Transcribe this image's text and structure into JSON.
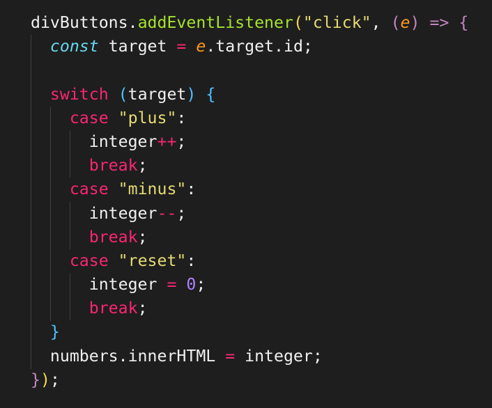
{
  "editor": {
    "background": "#1e1e1e",
    "lines": [
      [
        {
          "text": "divButtons.",
          "class": "tok-text"
        },
        {
          "text": "addEventListener",
          "class": "tok-method"
        },
        {
          "text": "(",
          "class": "tok-brace-yellow"
        },
        {
          "text": "\"click\"",
          "class": "tok-string"
        },
        {
          "text": ", ",
          "class": "tok-text"
        },
        {
          "text": "(",
          "class": "tok-brace-magenta"
        },
        {
          "text": "e",
          "class": "tok-param"
        },
        {
          "text": ")",
          "class": "tok-brace-magenta"
        },
        {
          "text": " ",
          "class": "tok-text"
        },
        {
          "text": "=>",
          "class": "tok-arrow"
        },
        {
          "text": " ",
          "class": "tok-text"
        },
        {
          "text": "{",
          "class": "tok-brace-magenta"
        }
      ],
      [
        {
          "text": "  ",
          "class": "tok-text"
        },
        {
          "text": "const",
          "class": "tok-storage"
        },
        {
          "text": " target ",
          "class": "tok-text"
        },
        {
          "text": "=",
          "class": "tok-keyword"
        },
        {
          "text": " ",
          "class": "tok-text"
        },
        {
          "text": "e",
          "class": "tok-param"
        },
        {
          "text": ".target.id;",
          "class": "tok-text"
        }
      ],
      [],
      [
        {
          "text": "  ",
          "class": "tok-text"
        },
        {
          "text": "switch",
          "class": "tok-keyword"
        },
        {
          "text": " ",
          "class": "tok-text"
        },
        {
          "text": "(",
          "class": "tok-brace-blue"
        },
        {
          "text": "target",
          "class": "tok-text"
        },
        {
          "text": ")",
          "class": "tok-brace-blue"
        },
        {
          "text": " ",
          "class": "tok-text"
        },
        {
          "text": "{",
          "class": "tok-brace-blue"
        }
      ],
      [
        {
          "text": "    ",
          "class": "tok-text"
        },
        {
          "text": "case",
          "class": "tok-keyword"
        },
        {
          "text": " ",
          "class": "tok-text"
        },
        {
          "text": "\"plus\"",
          "class": "tok-string"
        },
        {
          "text": ":",
          "class": "tok-text"
        }
      ],
      [
        {
          "text": "      integer",
          "class": "tok-text"
        },
        {
          "text": "++",
          "class": "tok-keyword"
        },
        {
          "text": ";",
          "class": "tok-text"
        }
      ],
      [
        {
          "text": "      ",
          "class": "tok-text"
        },
        {
          "text": "break",
          "class": "tok-keyword"
        },
        {
          "text": ";",
          "class": "tok-text"
        }
      ],
      [
        {
          "text": "    ",
          "class": "tok-text"
        },
        {
          "text": "case",
          "class": "tok-keyword"
        },
        {
          "text": " ",
          "class": "tok-text"
        },
        {
          "text": "\"minus\"",
          "class": "tok-string"
        },
        {
          "text": ":",
          "class": "tok-text"
        }
      ],
      [
        {
          "text": "      integer",
          "class": "tok-text"
        },
        {
          "text": "--",
          "class": "tok-keyword"
        },
        {
          "text": ";",
          "class": "tok-text"
        }
      ],
      [
        {
          "text": "      ",
          "class": "tok-text"
        },
        {
          "text": "break",
          "class": "tok-keyword"
        },
        {
          "text": ";",
          "class": "tok-text"
        }
      ],
      [
        {
          "text": "    ",
          "class": "tok-text"
        },
        {
          "text": "case",
          "class": "tok-keyword"
        },
        {
          "text": " ",
          "class": "tok-text"
        },
        {
          "text": "\"reset\"",
          "class": "tok-string"
        },
        {
          "text": ":",
          "class": "tok-text"
        }
      ],
      [
        {
          "text": "      integer ",
          "class": "tok-text"
        },
        {
          "text": "=",
          "class": "tok-keyword"
        },
        {
          "text": " ",
          "class": "tok-text"
        },
        {
          "text": "0",
          "class": "tok-number"
        },
        {
          "text": ";",
          "class": "tok-text"
        }
      ],
      [
        {
          "text": "      ",
          "class": "tok-text"
        },
        {
          "text": "break",
          "class": "tok-keyword"
        },
        {
          "text": ";",
          "class": "tok-text"
        }
      ],
      [
        {
          "text": "  ",
          "class": "tok-text"
        },
        {
          "text": "}",
          "class": "tok-brace-blue"
        }
      ],
      [
        {
          "text": "  numbers.innerHTML ",
          "class": "tok-text"
        },
        {
          "text": "=",
          "class": "tok-keyword"
        },
        {
          "text": " integer;",
          "class": "tok-text"
        }
      ],
      [
        {
          "text": "}",
          "class": "tok-brace-magenta"
        },
        {
          "text": ")",
          "class": "tok-brace-yellow"
        },
        {
          "text": ";",
          "class": "tok-text"
        }
      ]
    ]
  },
  "colors": {
    "text": "#f0f0f0",
    "method": "#a6e22e",
    "string": "#e6db74",
    "keyword": "#f92672",
    "storage": "#66d9ef",
    "param": "#fd971f",
    "number": "#ae81ff",
    "guide": "#404040"
  }
}
